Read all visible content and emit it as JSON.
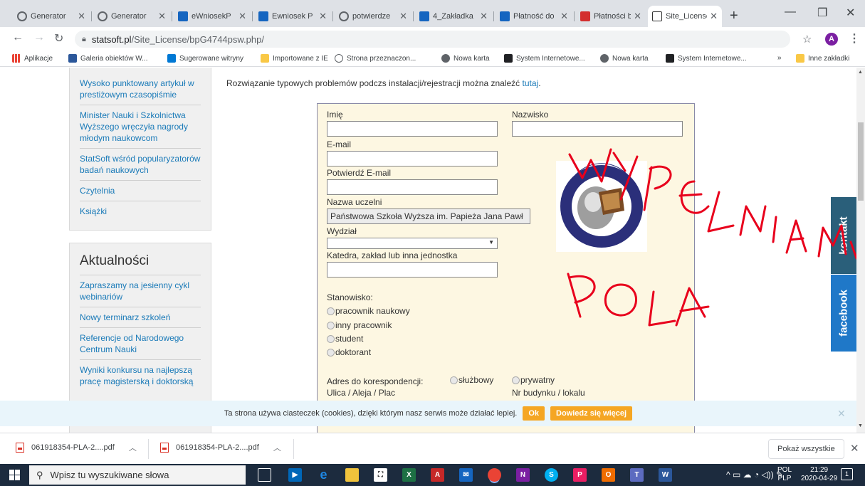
{
  "browser": {
    "tabs": [
      {
        "label": "Generator",
        "icon": "chrome-icon",
        "color": "#5f6368"
      },
      {
        "label": "Generator",
        "icon": "chrome-icon",
        "color": "#5f6368"
      },
      {
        "label": "eWniosekP",
        "icon": "portal-icon",
        "color": "#1565c0"
      },
      {
        "label": "Ewniosek P",
        "icon": "portal-icon",
        "color": "#1565c0"
      },
      {
        "label": "potwierdze",
        "icon": "globe-icon",
        "color": "#5f6368"
      },
      {
        "label": "4_Zakładka",
        "icon": "portal-icon",
        "color": "#1565c0"
      },
      {
        "label": "Płatność do",
        "icon": "portal-icon",
        "color": "#1565c0"
      },
      {
        "label": "Płatności b",
        "icon": "bank-icon",
        "color": "#d32f2f"
      },
      {
        "label": "Site_License",
        "icon": "statsoft-icon",
        "color": "#333333",
        "active": true
      }
    ],
    "url_host": "statsoft.pl",
    "url_path": "/Site_License/bpG4744psw.php/",
    "profile_initial": "A",
    "bookmarks": [
      {
        "label": "Aplikacje",
        "icon": "apps-grid-icon",
        "color": "#4285f4"
      },
      {
        "label": "Galeria obiektów W...",
        "icon": "gallery-icon",
        "color": "#2b579a"
      },
      {
        "label": "Sugerowane witryny",
        "icon": "bing-icon",
        "color": "#0078d4"
      },
      {
        "label": "Importowane z IE",
        "icon": "folder-icon",
        "color": "#f9c846"
      },
      {
        "label": "Strona przeznaczon...",
        "icon": "settings-icon",
        "color": "#5f6368"
      },
      {
        "label": "Nowa karta",
        "icon": "globe-icon",
        "color": "#5f6368"
      },
      {
        "label": "System Internetowe...",
        "icon": "mortarboard-icon",
        "color": "#202124"
      },
      {
        "label": "Nowa karta",
        "icon": "globe-icon",
        "color": "#5f6368"
      },
      {
        "label": "System Internetowe...",
        "icon": "mortarboard-icon",
        "color": "#202124"
      }
    ],
    "bookmarks_overflow": "»",
    "other_bookmarks": "Inne zakładki"
  },
  "sidebar": {
    "box1_links": [
      "Wysoko punktowany artykuł w prestiżowym czasopiśmie",
      "Minister Nauki i Szkolnictwa Wyższego wręczyła nagrody młodym naukowcom",
      "StatSoft wśród popularyzatorów badań naukowych",
      "Czytelnia",
      "Książki"
    ],
    "news_title": "Aktualności",
    "news_links": [
      "Zapraszamy na jesienny cykl webinariów",
      "Nowy terminarz szkoleń",
      "Referencje od Narodowego Centrum Nauki",
      "Wyniki konkursu na najlepszą pracę magisterską i doktorską"
    ]
  },
  "main": {
    "intro_text": "Rozwiązanie typowych problemów podczs instalacji/rejestracji można znaleźć ",
    "intro_link": "tutaj",
    "intro_end": ".",
    "form": {
      "first_name_label": "Imię",
      "last_name_label": "Nazwisko",
      "email_label": "E-mail",
      "email_confirm_label": "Potwierdź E-mail",
      "university_label": "Nazwa uczelni",
      "university_value": "Państwowa Szkoła Wyższa im. Papieża Jana Pawł",
      "faculty_label": "Wydział",
      "department_label": "Katedra, zakład lub inna jednostka",
      "position_label": "Stanowisko:",
      "positions": [
        "pracownik naukowy",
        "inny pracownik",
        "student",
        "doktorant"
      ],
      "address_label": "Adres do korespondencji:",
      "address_options": [
        "służbowy",
        "prywatny"
      ],
      "street_label": "Ulica / Aleja / Plac",
      "building_label": "Nr budynku / lokalu"
    },
    "annotation_line1": "WYPEŁNIAMY",
    "annotation_line2": "POLA",
    "annotation_color": "#e8001c"
  },
  "side_tabs": {
    "contact": "kontakt",
    "facebook": "facebook"
  },
  "cookie": {
    "text": "Ta strona używa ciasteczek (cookies), dzięki którym nasz serwis może działać lepiej.",
    "ok": "Ok",
    "more": "Dowiedz się więcej"
  },
  "downloads": {
    "items": [
      "061918354-PLA-2....pdf",
      "061918354-PLA-2....pdf"
    ],
    "show_all": "Pokaż wszystkie"
  },
  "taskbar": {
    "search_placeholder": "Wpisz tu wyszukiwane słowa",
    "lang_top": "POL",
    "lang_bottom": "PLP",
    "time": "21:29",
    "date": "2020-04-29",
    "notification_count": "1"
  }
}
